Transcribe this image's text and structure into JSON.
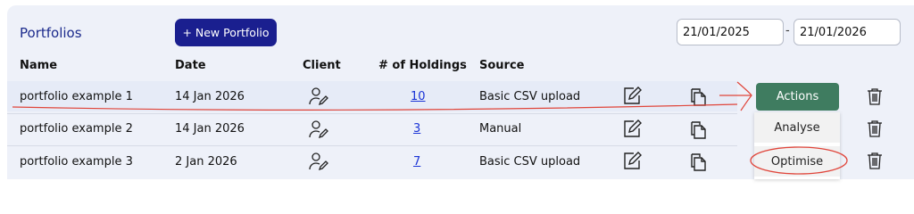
{
  "header": {
    "title": "Portfolios",
    "new_button": "+ New Portfolio",
    "date_from": "21/01/2025",
    "date_separator": "-",
    "date_to": "21/01/2026"
  },
  "columns": {
    "name": "Name",
    "date": "Date",
    "client": "Client",
    "holdings": "# of Holdings",
    "source": "Source"
  },
  "rows": [
    {
      "name": "portfolio example 1",
      "date": "14 Jan 2026",
      "holdings": "10",
      "source": "Basic CSV upload"
    },
    {
      "name": "portfolio example 2",
      "date": "14 Jan 2026",
      "holdings": "3",
      "source": "Manual"
    },
    {
      "name": "portfolio example 3",
      "date": "2 Jan 2026",
      "holdings": "7",
      "source": "Basic CSV upload"
    }
  ],
  "actions": {
    "button": "Actions",
    "menu": [
      "Analyse",
      "Optimise"
    ]
  },
  "colors": {
    "accent": "#1a1f8f",
    "actions_button": "#3f7c60",
    "annotation": "#e0453a"
  },
  "icons": [
    "client-edit-icon",
    "edit-icon",
    "copy-icon",
    "trash-icon"
  ]
}
